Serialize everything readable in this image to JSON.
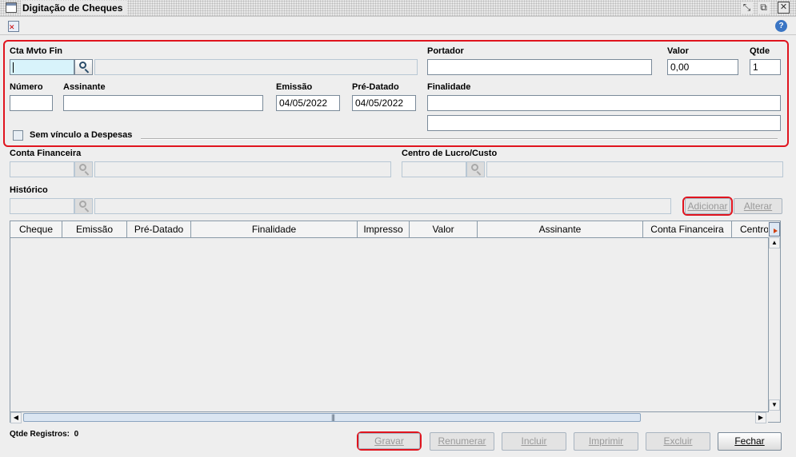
{
  "window": {
    "title": "Digitação de Cheques",
    "controls": [
      "restore-icon",
      "popout-icon",
      "close-icon"
    ],
    "close_glyph": "✕"
  },
  "toolbar": {
    "icons": [
      "close-form-icon",
      "help-icon"
    ],
    "help_glyph": "?"
  },
  "form": {
    "cta_mvto_fin": {
      "label": "Cta Mvto Fin",
      "value": "",
      "description": ""
    },
    "portador": {
      "label": "Portador",
      "value": ""
    },
    "valor": {
      "label": "Valor",
      "value": "0,00"
    },
    "qtde": {
      "label": "Qtde",
      "value": "1"
    },
    "numero": {
      "label": "Número",
      "value": ""
    },
    "assinante": {
      "label": "Assinante",
      "value": ""
    },
    "emissao": {
      "label": "Emissão",
      "value": "04/05/2022"
    },
    "pre_datado": {
      "label": "Pré-Datado",
      "value": "04/05/2022"
    },
    "finalidade": {
      "label": "Finalidade",
      "line1": "",
      "line2": ""
    },
    "sem_vinculo": {
      "label": "Sem vínculo a Despesas",
      "checked": false
    }
  },
  "lower_form": {
    "conta_financeira": {
      "label": "Conta Financeira",
      "value": "",
      "description": ""
    },
    "centro_lucro": {
      "label": "Centro de Lucro/Custo",
      "value": "",
      "description": ""
    },
    "historico": {
      "label": "Histórico",
      "value": "",
      "description": ""
    },
    "buttons": {
      "adicionar": "Adicionar",
      "alterar": "Alterar"
    }
  },
  "grid": {
    "columns": [
      "Cheque",
      "Emissão",
      "Pré-Datado",
      "Finalidade",
      "Impresso",
      "Valor",
      "Assinante",
      "Conta Financeira",
      "Centro"
    ],
    "rows": []
  },
  "footer": {
    "count_label": "Qtde Registros:",
    "count_value": "0",
    "buttons": {
      "gravar": "Gravar",
      "renumerar": "Renumerar",
      "incluir": "Incluir",
      "imprimir": "Imprimir",
      "excluir": "Excluir",
      "fechar": "Fechar"
    }
  },
  "colors": {
    "highlight": "#e0141e",
    "focus_field": "#d8f3fb",
    "background": "#eeeeee"
  }
}
